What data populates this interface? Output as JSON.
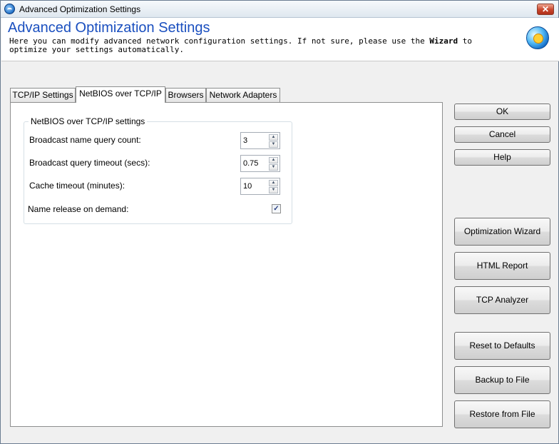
{
  "window": {
    "title": "Advanced Optimization Settings",
    "close_symbol": "✕"
  },
  "header": {
    "title": "Advanced Optimization Settings",
    "desc_before": "Here you can modify advanced network configuration settings. If not sure, please use the ",
    "desc_bold": "Wizard",
    "desc_after": " to optimize your settings automatically."
  },
  "tabs": [
    {
      "label": "TCP/IP Settings",
      "active": false
    },
    {
      "label": "NetBIOS over TCP/IP",
      "active": true
    },
    {
      "label": "Browsers",
      "active": false
    },
    {
      "label": "Network Adapters",
      "active": false
    }
  ],
  "netbios": {
    "group_title": "NetBIOS over TCP/IP settings",
    "broadcast_count_label": "Broadcast name query count:",
    "broadcast_count_value": "3",
    "broadcast_timeout_label": "Broadcast query timeout (secs):",
    "broadcast_timeout_value": "0.75",
    "cache_timeout_label": "Cache timeout (minutes):",
    "cache_timeout_value": "10",
    "name_release_label": "Name release on demand:",
    "name_release_checked": true,
    "check_mark": "✓",
    "spin_up": "▲",
    "spin_down": "▼"
  },
  "buttons": {
    "ok": "OK",
    "cancel": "Cancel",
    "help": "Help",
    "wizard": "Optimization Wizard",
    "html_report": "HTML Report",
    "tcp_analyzer": "TCP Analyzer",
    "reset": "Reset to Defaults",
    "backup": "Backup to File",
    "restore": "Restore from File"
  },
  "icons": {
    "app": "app-globe-icon",
    "header_logo": "logo-globe-icon"
  }
}
